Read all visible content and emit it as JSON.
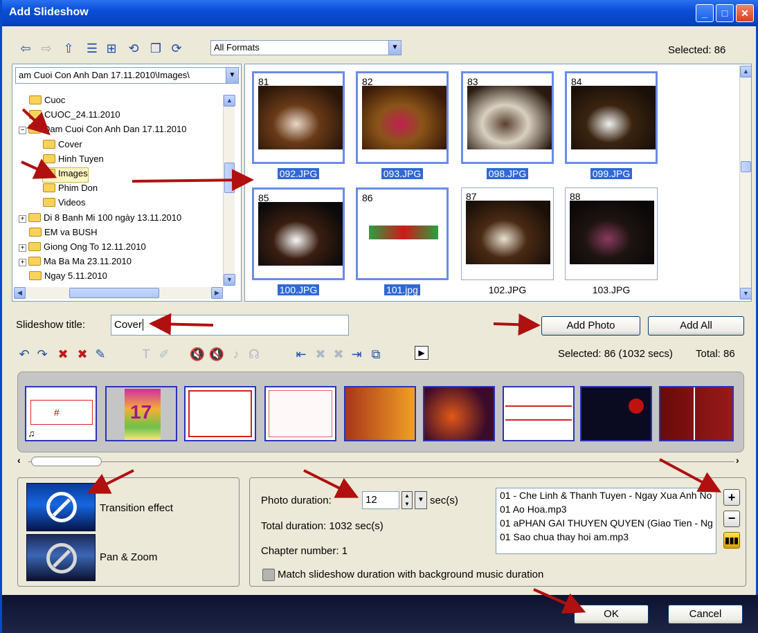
{
  "window": {
    "title": "Add Slideshow"
  },
  "toolbar": {
    "format_select": "All Formats",
    "selected_text": "Selected: 86",
    "icons": [
      "back-arrow-icon",
      "forward-arrow-icon",
      "up-folder-icon",
      "view-list-icon",
      "tree-icon",
      "folder-refresh-icon",
      "copy-icon",
      "refresh-icon"
    ]
  },
  "folder_tree": {
    "path": "am Cuoi Con Anh Dan 17.11.2010\\Images\\",
    "items": [
      {
        "label": "Cuoc",
        "indent": 1,
        "expander": ""
      },
      {
        "label": "CUOC_24.11.2010",
        "indent": 1,
        "expander": ""
      },
      {
        "label": "Dam Cuoi Con Anh Dan 17.11.2010",
        "indent": 1,
        "expander": "−"
      },
      {
        "label": "Cover",
        "indent": 2,
        "expander": ""
      },
      {
        "label": "Hinh Tuyen",
        "indent": 2,
        "expander": ""
      },
      {
        "label": "Images",
        "indent": 2,
        "expander": "",
        "selected": true
      },
      {
        "label": "Phim Don",
        "indent": 2,
        "expander": ""
      },
      {
        "label": "Videos",
        "indent": 2,
        "expander": ""
      },
      {
        "label": "Di 8 Banh Mi 100 ngày 13.11.2010",
        "indent": 1,
        "expander": "+"
      },
      {
        "label": "EM va BUSH",
        "indent": 1,
        "expander": ""
      },
      {
        "label": "Giong Ong To 12.11.2010",
        "indent": 1,
        "expander": "+"
      },
      {
        "label": "Ma Ba Ma 23.11.2010",
        "indent": 1,
        "expander": "+"
      },
      {
        "label": "Ngay 5.11.2010",
        "indent": 1,
        "expander": ""
      }
    ]
  },
  "thumbnails": [
    {
      "num": "81",
      "file": "092.JPG",
      "selected": true
    },
    {
      "num": "82",
      "file": "093.JPG",
      "selected": true
    },
    {
      "num": "83",
      "file": "098.JPG",
      "selected": true
    },
    {
      "num": "84",
      "file": "099.JPG",
      "selected": true
    },
    {
      "num": "85",
      "file": "100.JPG",
      "selected": true
    },
    {
      "num": "86",
      "file": "101.jpg",
      "selected": true
    },
    {
      "num": "87",
      "file": "102.JPG",
      "selected": false
    },
    {
      "num": "88",
      "file": "103.JPG",
      "selected": false
    }
  ],
  "slideshow": {
    "title_label": "Slideshow title:",
    "title_value": "Cover",
    "add_photo": "Add Photo",
    "add_all": "Add All",
    "selected_summary": "Selected: 86 (1032 secs)",
    "total_summary": "Total: 86"
  },
  "effects": {
    "transition": "Transition effect",
    "pan_zoom": "Pan & Zoom"
  },
  "settings": {
    "photo_duration_label": "Photo duration:",
    "photo_duration_value": "12",
    "unit": "sec(s)",
    "total_duration": "Total duration: 1032 sec(s)",
    "chapter_number": "Chapter number: 1",
    "match_label": "Match slideshow duration with background music duration",
    "music": [
      "01 - Che Linh & Thanh Tuyen - Ngay Xua Anh No",
      "01 Ao Hoa.mp3",
      "01 aPHAN GAI THUYEN QUYEN (Giao Tien - Ng",
      "01 Sao chua thay hoi am.mp3"
    ]
  },
  "footer": {
    "ok": "OK",
    "cancel": "Cancel"
  },
  "colors": {
    "title_blue": "#0a4ed8",
    "selection": "#3168d5",
    "arrow_red": "#b01010"
  }
}
